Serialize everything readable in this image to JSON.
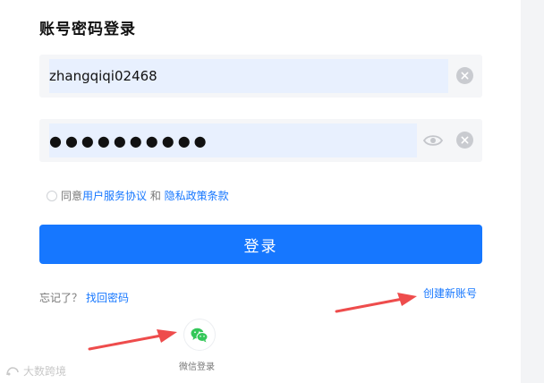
{
  "login": {
    "title": "账号密码登录",
    "username_value": "zhangqiqi02468",
    "password_value": "●●●●●●●●●●",
    "agreement": {
      "prefix": "同意",
      "terms_link": "用户服务协议",
      "and": " 和 ",
      "privacy_link": "隐私政策条款"
    },
    "submit_label": "登录",
    "forgot_prefix": "忘记了？",
    "forgot_link": "找回密码",
    "create_account": "创建新账号",
    "wechat_label": "微信登录"
  },
  "watermark": {
    "text": "大数跨境"
  },
  "colors": {
    "accent": "#1677ff",
    "annotation_arrow": "#ee4c4c",
    "wechat_green": "#34c759"
  },
  "icons": {
    "clear": "close-circle-icon",
    "eye": "eye-icon",
    "wechat": "wechat-icon"
  }
}
